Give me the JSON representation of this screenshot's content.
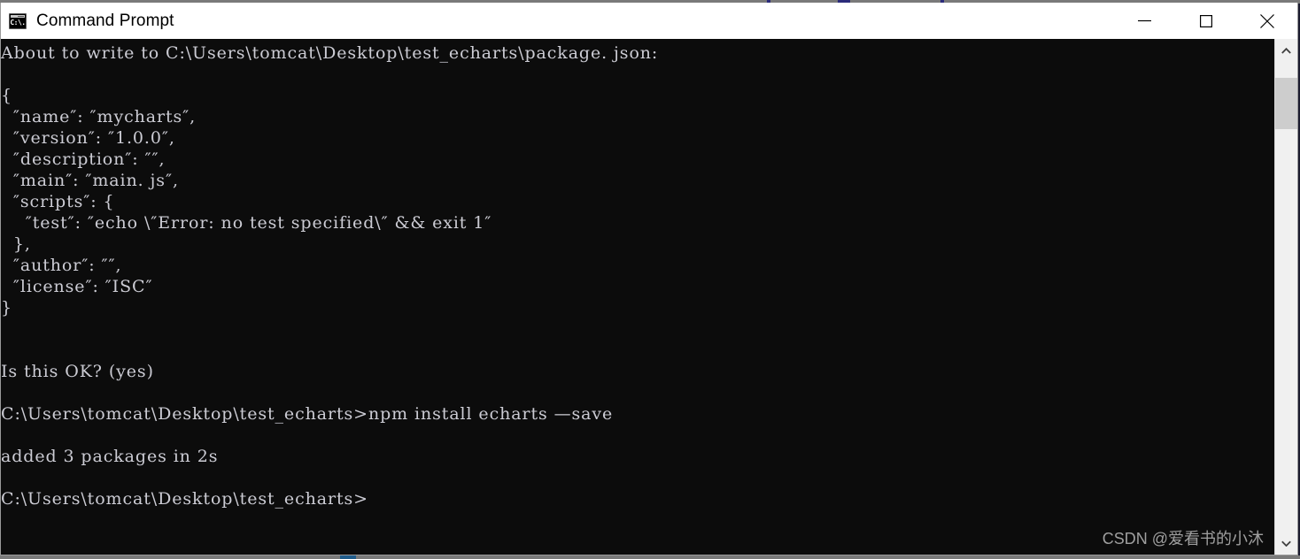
{
  "window": {
    "title": "Command Prompt",
    "icon": "command-prompt-icon",
    "icon_glyph": "C:\\.",
    "minimize_label": "Minimize",
    "maximize_label": "Maximize",
    "close_label": "Close",
    "background_color": "#0c0c0c",
    "foreground_color": "#ccccd4",
    "titlebar_color": "#ffffff"
  },
  "console": {
    "lines": [
      "About to write to C:\\Users\\tomcat\\Desktop\\test_echarts\\package. json:",
      "",
      "{",
      "  ″name″: ″mycharts″,",
      "  ″version″: ″1.0.0″,",
      "  ″description″: ″″,",
      "  ″main″: ″main. js″,",
      "  ″scripts″: {",
      "    ″test″: ″echo \\″Error: no test specified\\″ && exit 1″",
      "  },",
      "  ″author″: ″″,",
      "  ″license″: ″ISC″",
      "}",
      "",
      "",
      "Is this OK? (yes)",
      "",
      "C:\\Users\\tomcat\\Desktop\\test_echarts>npm install echarts —save",
      "",
      "added 3 packages in 2s",
      "",
      "C:\\Users\\tomcat\\Desktop\\test_echarts>"
    ]
  },
  "watermark": {
    "text": "CSDN @爱看书的小沐"
  },
  "scrollbar": {
    "up_arrow": "chevron-up-icon",
    "down_arrow": "chevron-down-icon"
  }
}
